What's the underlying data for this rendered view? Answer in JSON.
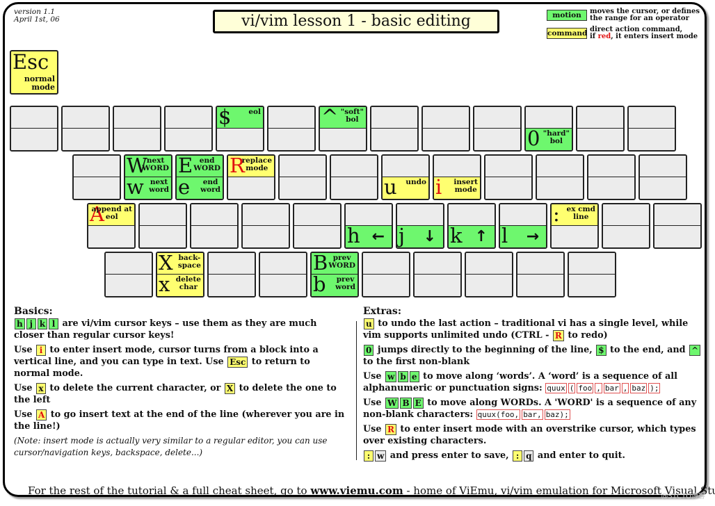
{
  "header": {
    "version": "version 1.1",
    "date": "April 1st, 06",
    "title": "vi/vim lesson 1 - basic editing"
  },
  "legend": [
    {
      "swatch": "motion",
      "color": "#6ef76e",
      "desc1": "moves the cursor, or defines",
      "desc2": "the range for an operator"
    },
    {
      "swatch": "command",
      "color": "#ffff70",
      "desc1": "direct action command,",
      "desc2_pre": "if ",
      "desc2_red": "red",
      "desc2_post": ", it enters insert mode"
    }
  ],
  "colors": {
    "motion": "#6ef76e",
    "command": "#ffff70",
    "empty": "#ececec",
    "insert_red": "#e01010",
    "title_bg": "#ffffd8"
  },
  "esc_key": {
    "glyph": "Esc",
    "label1": "normal",
    "label2": "mode"
  },
  "keyboard": {
    "row1": [
      {},
      {},
      {},
      {},
      {
        "top": {
          "glyph": "$",
          "desc": "eol",
          "type": "motion"
        }
      },
      {},
      {
        "top": {
          "glyph": "^",
          "desc": "\"soft\" bol",
          "type": "motion"
        }
      },
      {},
      {},
      {},
      {
        "bot": {
          "glyph": "0",
          "desc": "\"hard\" bol",
          "type": "motion"
        }
      },
      {},
      {}
    ],
    "row2": [
      {},
      {
        "top": {
          "glyph": "W",
          "desc": "next WORD",
          "type": "motion"
        },
        "bot": {
          "glyph": "w",
          "desc": "next word",
          "type": "motion"
        }
      },
      {
        "top": {
          "glyph": "E",
          "desc": "end WORD",
          "type": "motion"
        },
        "bot": {
          "glyph": "e",
          "desc": "end word",
          "type": "motion"
        }
      },
      {
        "top": {
          "glyph": "R",
          "desc": "replace mode",
          "type": "command",
          "red": true
        }
      },
      {},
      {},
      {
        "bot": {
          "glyph": "u",
          "desc": "undo",
          "type": "command"
        }
      },
      {
        "bot": {
          "glyph": "i",
          "desc": "insert mode",
          "type": "command",
          "red": true
        }
      },
      {},
      {},
      {},
      {}
    ],
    "row3": [
      {
        "top": {
          "glyph": "A",
          "desc": "append at eol",
          "type": "command",
          "red": true
        }
      },
      {},
      {},
      {},
      {},
      {
        "bot": {
          "glyph": "h",
          "arrow": "←",
          "type": "motion"
        }
      },
      {
        "bot": {
          "glyph": "j",
          "arrow": "↓",
          "type": "motion"
        }
      },
      {
        "bot": {
          "glyph": "k",
          "arrow": "↑",
          "type": "motion"
        }
      },
      {
        "bot": {
          "glyph": "l",
          "arrow": "→",
          "type": "motion"
        }
      },
      {
        "top": {
          "glyph": ":",
          "desc": "ex cmd line",
          "type": "command"
        }
      },
      {},
      {}
    ],
    "row4": [
      {},
      {
        "top": {
          "glyph": "X",
          "desc": "back- space",
          "type": "command"
        },
        "bot": {
          "glyph": "x",
          "desc": "delete char",
          "type": "command"
        }
      },
      {},
      {},
      {
        "top": {
          "glyph": "B",
          "desc": "prev WORD",
          "type": "motion"
        },
        "bot": {
          "glyph": "b",
          "desc": "prev word",
          "type": "motion"
        }
      },
      {},
      {},
      {},
      {},
      {}
    ]
  },
  "basics": {
    "heading": "Basics:",
    "p1_keys": [
      "h",
      "j",
      "k",
      "l"
    ],
    "p1_text": " are vi/vim cursor keys – use them as they are  much closer than regular cursor keys!",
    "p2_a": "Use ",
    "p2_key": "i",
    "p2_b": " to enter insert mode, cursor turns from a block into a vertical line, and you can type in text. Use ",
    "p2_key2": "Esc",
    "p2_c": "  to  return to normal mode.",
    "p3_a": "Use ",
    "p3_key": "x",
    "p3_b": " to delete the current character, or ",
    "p3_key2": "X",
    "p3_c": "  to delete the one to the left",
    "p4_a": "Use ",
    "p4_key": "A",
    "p4_b": "  to go insert text at the end of the line (wherever you are in the line!)",
    "note": " (Note: insert mode is actually very similar to a regular editor, you can use cursor/navigation keys, backspace,  delete...)"
  },
  "extras": {
    "heading": "Extras:",
    "p1_key": "u",
    "p1_a": " to undo the last action – traditional vi has a single level, while vim supports unlimited undo (CTRL - ",
    "p1_key2": "R",
    "p1_b": " to redo)",
    "p2_key": "0",
    "p2_a": " jumps directly to the beginning of the line, ",
    "p2_key2": "$",
    "p2_b": " to the end, and ",
    "p2_key3": "^",
    "p2_c": " to the first non-blank",
    "p3_a": "Use ",
    "p3_keys": [
      "w",
      "b",
      "e"
    ],
    "p3_b": " to move along ‘words’. A ‘word’ is a sequence of all alphanumeric or punctuation signs:   ",
    "p3_code": [
      "quux",
      "(",
      "foo",
      ",",
      "bar",
      ",",
      "baz",
      ");"
    ],
    "p4_a": "Use ",
    "p4_keys": [
      "W",
      "B",
      "E"
    ],
    "p4_b": " to move along WORDs. A 'WORD' is a sequence of any non-blank characters:   ",
    "p4_code": [
      "quux(foo,",
      "bar,",
      "baz);"
    ],
    "p5_a": "Use ",
    "p5_key": "R",
    "p5_b": " to enter insert mode with an overstrike cursor, which types over existing characters.",
    "p6_key1": ":",
    "p6_key2": "w",
    "p6_a": " and press enter to save, ",
    "p6_key3": ":",
    "p6_key4": "q",
    "p6_b": " and enter to quit."
  },
  "footer": {
    "pre": "For the rest of the tutorial & a full cheat sheet, go to ",
    "link": "www.viemu.com",
    "post": " - home of ViEmu, vi/vim emulation for Microsoft Visual Studio"
  },
  "watermark": "@51CTO博客"
}
